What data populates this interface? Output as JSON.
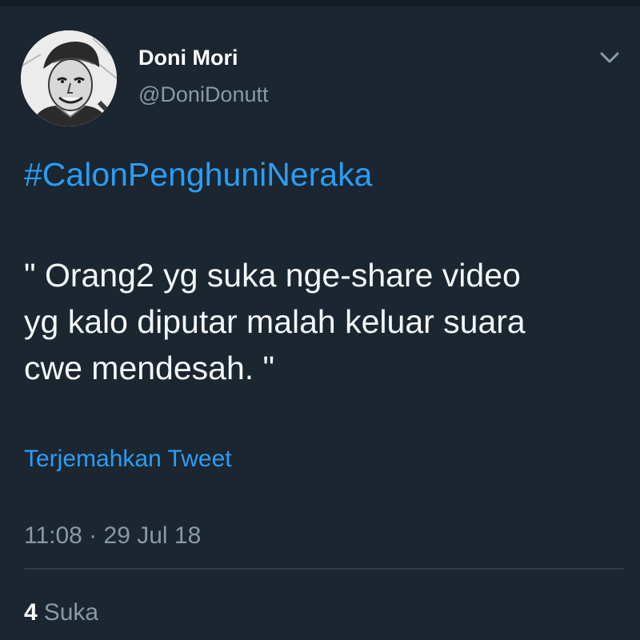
{
  "tweet": {
    "author": {
      "display_name": "Doni Mori",
      "handle": "@DoniDonutt",
      "avatar_icon": "profile-photo-sketch"
    },
    "menu_icon": "chevron-down-icon",
    "hashtag": "#CalonPenghuniNeraka",
    "body_lines": [
      "\" Orang2 yg suka nge-share video",
      "yg kalo diputar malah keluar suara",
      "cwe mendesah. \""
    ],
    "translate_label": "Terjemahkan Tweet",
    "timestamp": "11:08 · 29 Jul 18",
    "stats": {
      "likes_count": "4",
      "likes_label": "Suka"
    }
  },
  "colors": {
    "background": "#1b2631",
    "link": "#2a9df4",
    "secondary_text": "#8a99a6",
    "primary_text": "#f5f8fa",
    "divider": "#2f3d4a"
  }
}
